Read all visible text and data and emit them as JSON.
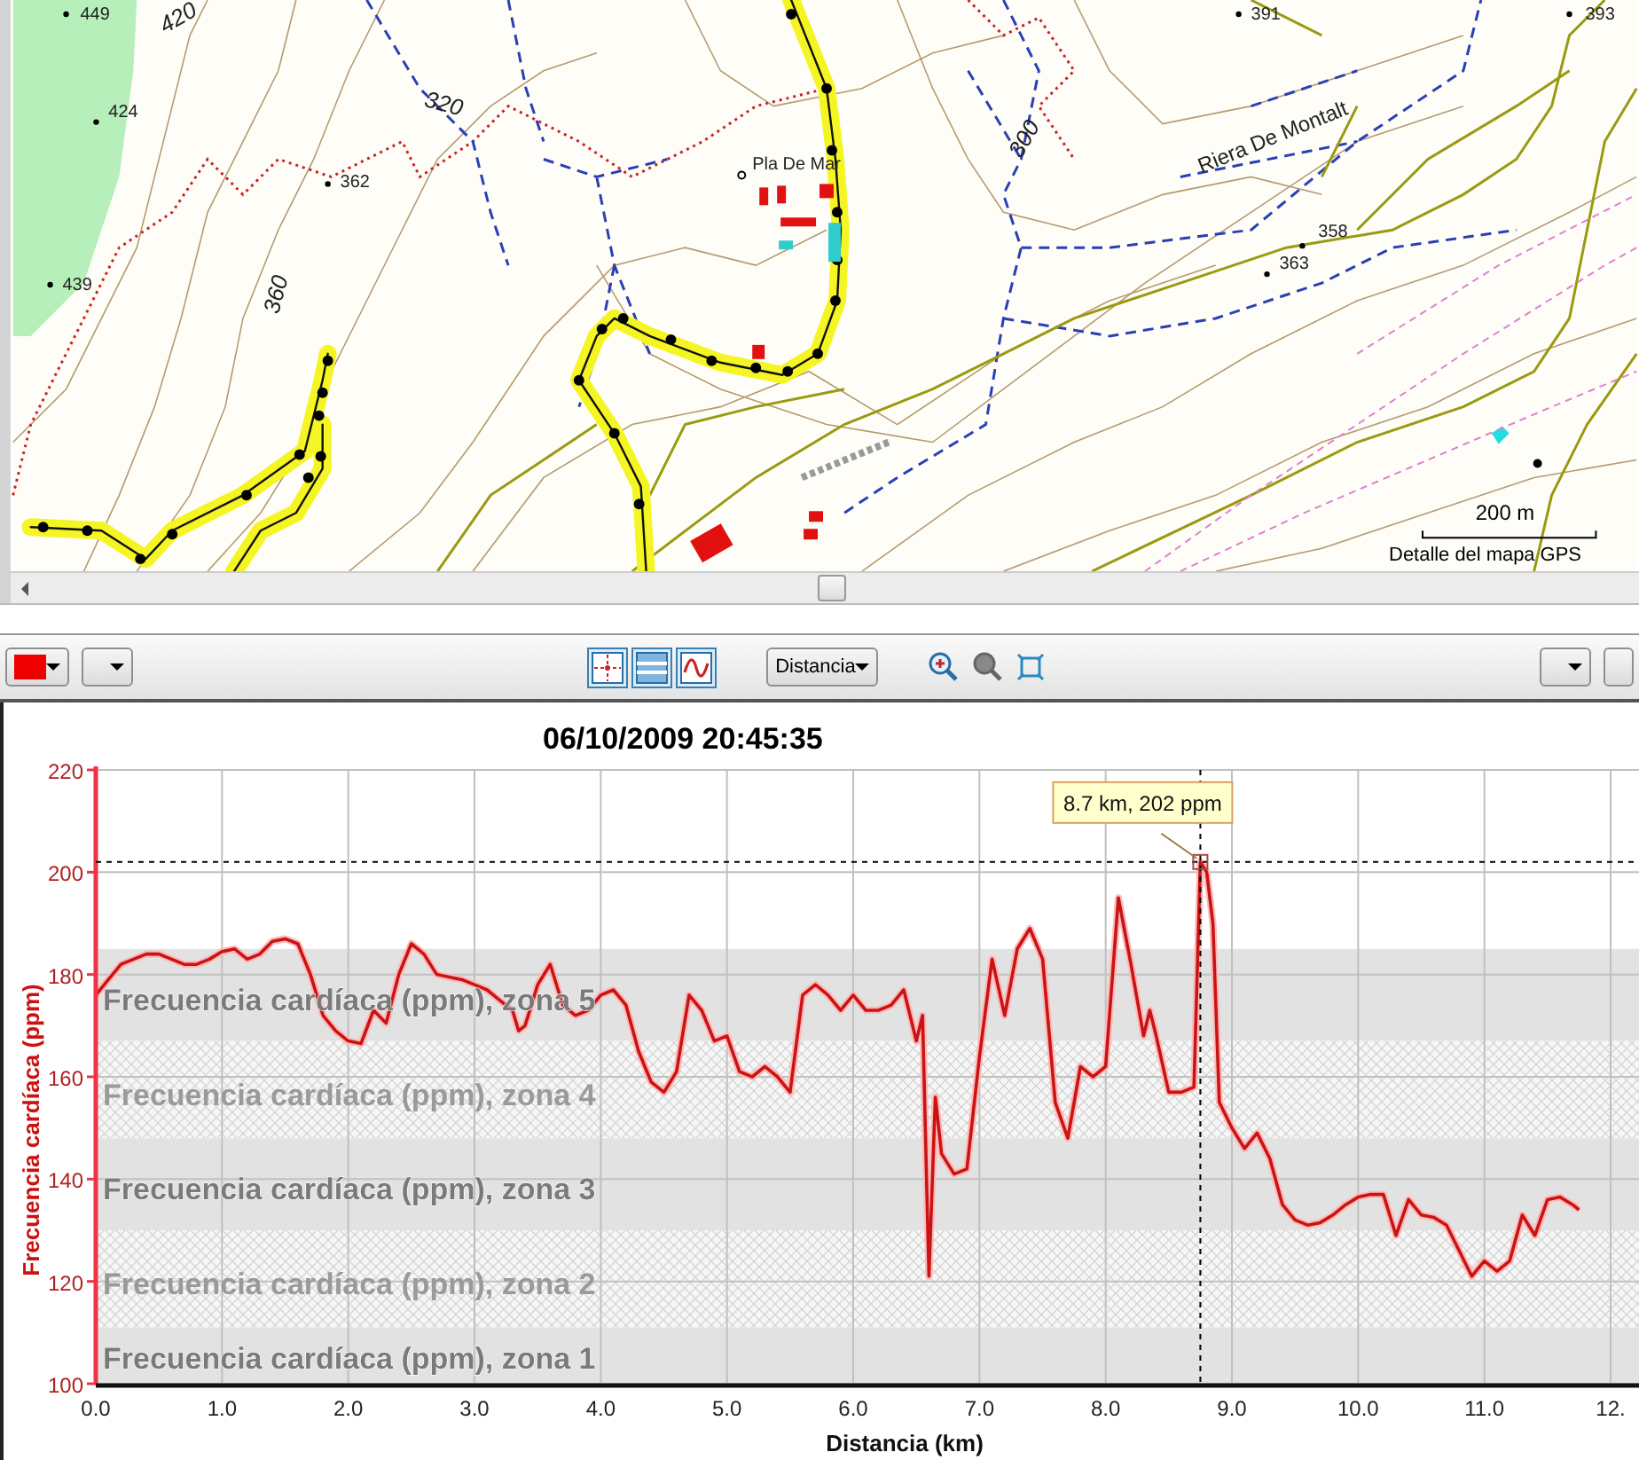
{
  "map": {
    "labels": [
      {
        "text": "449"
      },
      {
        "text": "420"
      },
      {
        "text": "424"
      },
      {
        "text": "439"
      },
      {
        "text": "362"
      },
      {
        "text": "360"
      },
      {
        "text": "320"
      },
      {
        "text": "Pla De Mar"
      },
      {
        "text": "300"
      },
      {
        "text": "Riera De Montalt"
      },
      {
        "text": "391"
      },
      {
        "text": "393"
      },
      {
        "text": "358"
      },
      {
        "text": "363"
      }
    ],
    "scale": "200 m",
    "caption": "Detalle del mapa GPS"
  },
  "toolbar": {
    "axis_dropdown": "Distancia"
  },
  "chart": {
    "chart_data": {
      "type": "line",
      "title": "06/10/2009 20:45:35",
      "xlabel": "Distancia (km)",
      "ylabel": "Frecuencia cardíaca (ppm)",
      "x": [
        0,
        0.1,
        0.2,
        0.3,
        0.4,
        0.5,
        0.6,
        0.7,
        0.8,
        0.9,
        1,
        1.1,
        1.2,
        1.3,
        1.4,
        1.5,
        1.6,
        1.7,
        1.8,
        1.9,
        2,
        2.1,
        2.2,
        2.3,
        2.4,
        2.5,
        2.6,
        2.7,
        2.8,
        2.9,
        3,
        3.1,
        3.2,
        3.3,
        3.35,
        3.4,
        3.5,
        3.6,
        3.7,
        3.8,
        3.9,
        4,
        4.1,
        4.2,
        4.3,
        4.4,
        4.5,
        4.6,
        4.7,
        4.8,
        4.9,
        5,
        5.1,
        5.2,
        5.3,
        5.4,
        5.5,
        5.6,
        5.7,
        5.8,
        5.9,
        6,
        6.1,
        6.2,
        6.3,
        6.4,
        6.5,
        6.55,
        6.6,
        6.65,
        6.7,
        6.8,
        6.9,
        7,
        7.1,
        7.2,
        7.3,
        7.4,
        7.5,
        7.6,
        7.7,
        7.8,
        7.9,
        8,
        8.1,
        8.2,
        8.3,
        8.35,
        8.4,
        8.5,
        8.6,
        8.7,
        8.75,
        8.8,
        8.85,
        8.9,
        9,
        9.1,
        9.2,
        9.3,
        9.4,
        9.5,
        9.6,
        9.7,
        9.8,
        9.9,
        10,
        10.1,
        10.2,
        10.3,
        10.4,
        10.5,
        10.6,
        10.7,
        10.8,
        10.9,
        11,
        11.1,
        11.2,
        11.3,
        11.4,
        11.5,
        11.6,
        11.7,
        11.75
      ],
      "series": [
        {
          "color": "#c81414",
          "values": [
            176,
            179,
            182,
            183,
            184,
            184,
            183,
            182,
            182,
            183,
            184.5,
            185,
            183,
            184,
            186.5,
            187,
            186,
            180,
            172,
            169,
            167,
            166.5,
            173,
            170.5,
            180,
            186,
            184,
            180,
            179.5,
            179,
            178,
            177,
            175,
            173,
            169,
            170,
            178,
            182,
            174,
            172,
            173,
            176,
            177,
            174,
            165,
            159,
            157,
            161,
            176,
            173,
            167,
            168,
            161,
            160,
            162,
            160,
            157,
            176,
            178,
            176,
            173,
            176,
            173,
            173,
            174,
            177,
            167,
            172,
            121,
            156,
            145,
            141,
            142,
            164,
            183,
            172,
            185,
            189,
            183,
            155,
            148,
            162,
            160,
            162,
            195,
            182,
            168,
            173,
            168,
            157,
            157,
            158,
            202,
            200,
            190,
            155,
            150,
            146,
            149,
            144,
            135,
            132,
            131,
            131.5,
            133,
            135,
            136.5,
            137,
            137,
            129,
            136,
            133,
            132.5,
            131,
            126,
            121,
            124,
            122,
            124,
            133,
            129,
            136,
            136.5,
            135,
            134
          ]
        }
      ],
      "xlim": [
        0,
        12
      ],
      "ylim": [
        100,
        220
      ],
      "xticks": [
        {
          "value": 0,
          "label": "0.0"
        },
        {
          "value": 1,
          "label": "1.0"
        },
        {
          "value": 2,
          "label": "2.0"
        },
        {
          "value": 3,
          "label": "3.0"
        },
        {
          "value": 4,
          "label": "4.0"
        },
        {
          "value": 5,
          "label": "5.0"
        },
        {
          "value": 6,
          "label": "6.0"
        },
        {
          "value": 7,
          "label": "7.0"
        },
        {
          "value": 8,
          "label": "8.0"
        },
        {
          "value": 9,
          "label": "9.0"
        },
        {
          "value": 10,
          "label": "10.0"
        },
        {
          "value": 11,
          "label": "11.0"
        },
        {
          "value": 12,
          "label": "12."
        }
      ],
      "yticks": [
        100,
        120,
        140,
        160,
        180,
        200,
        220
      ],
      "grid": true,
      "bands": [
        {
          "axis": "y",
          "from": 167,
          "to": 185,
          "label": "Frecuencia cardíaca (ppm), zona 5"
        },
        {
          "axis": "y",
          "from": 148,
          "to": 167,
          "label": "Frecuencia cardíaca (ppm), zona 4"
        },
        {
          "axis": "y",
          "from": 130,
          "to": 148,
          "label": "Frecuencia cardíaca (ppm), zona 3"
        },
        {
          "axis": "y",
          "from": 111,
          "to": 130,
          "label": "Frecuencia cardíaca (ppm), zona 2"
        },
        {
          "axis": "y",
          "from": 100,
          "to": 111,
          "label": "Frecuencia cardíaca (ppm), zona 1"
        }
      ],
      "ref_lines": [
        {
          "axis": "y",
          "value": 202
        },
        {
          "axis": "x",
          "value": 8.75
        }
      ],
      "annotations": [
        {
          "x": 8.75,
          "y": 202,
          "text": "8.7 km, 202 ppm"
        }
      ]
    }
  }
}
